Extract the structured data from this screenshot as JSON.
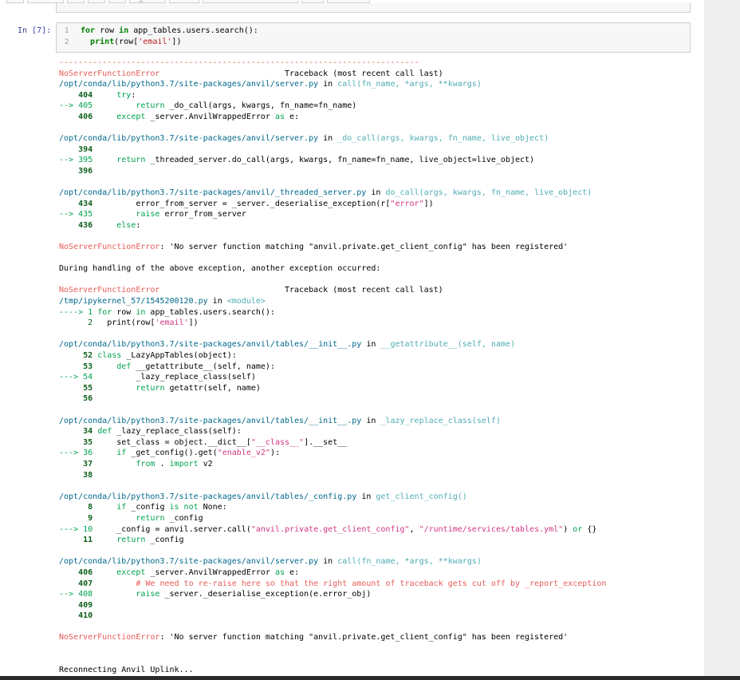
{
  "cell": {
    "prompt": "In [7]:",
    "lines": [
      {
        "num": "1",
        "text": "for row in app_tables.users.search():"
      },
      {
        "num": "2",
        "text": "  print(row['email'])"
      }
    ]
  },
  "traceback": {
    "separator": "---------------------------------------------------------------------------",
    "error_name": "NoServerFunctionError",
    "header_right": "Traceback (most recent call last)",
    "frames": [
      {
        "path": "/opt/conda/lib/python3.7/site-packages/anvil/server.py",
        "in": "in",
        "func": "call(fn_name, *args, **kwargs)"
      },
      {
        "path": "/opt/conda/lib/python3.7/site-packages/anvil/server.py",
        "in": "in",
        "func": "_do_call(args, kwargs, fn_name, live_object)"
      },
      {
        "path": "/opt/conda/lib/python3.7/site-packages/anvil/_threaded_server.py",
        "in": "in",
        "func": "do_call(args, kwargs, fn_name, live_object)"
      }
    ],
    "message": ": 'No server function matching \"anvil.private.get_client_config\" has been registered'",
    "during": "During handling of the above exception, another exception occurred:",
    "frames2": [
      {
        "path": "/tmp/ipykernel_57/1545200120.py",
        "in": "in",
        "func": "<module>"
      },
      {
        "path": "/opt/conda/lib/python3.7/site-packages/anvil/tables/__init__.py",
        "in": "in",
        "func": "__getattribute__(self, name)"
      },
      {
        "path": "/opt/conda/lib/python3.7/site-packages/anvil/tables/__init__.py",
        "in": "in",
        "func": "_lazy_replace_class(self)"
      },
      {
        "path": "/opt/conda/lib/python3.7/site-packages/anvil/tables/_config.py",
        "in": "in",
        "func": "get_client_config()"
      },
      {
        "path": "/opt/conda/lib/python3.7/site-packages/anvil/server.py",
        "in": "in",
        "func": "call(fn_name, *args, **kwargs)"
      }
    ],
    "final_message": ": 'No server function matching \"anvil.private.get_client_config\" has been registered'",
    "stdout": "Reconnecting Anvil Uplink..."
  }
}
